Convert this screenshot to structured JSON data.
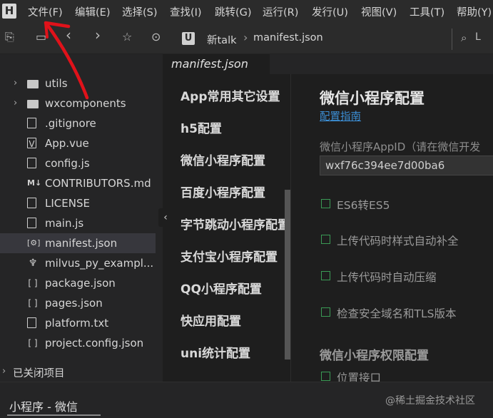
{
  "menu": [
    "文件(F)",
    "编辑(E)",
    "选择(S)",
    "查找(I)",
    "跳转(G)",
    "运行(R)",
    "发行(U)",
    "视图(V)",
    "工具(T)",
    "帮助(Y)"
  ],
  "app_logo": "H",
  "breadcrumb": {
    "logo": "U",
    "project": "新talk",
    "separator": "›",
    "file": "manifest.json"
  },
  "toolbar_icons": [
    "save-icon",
    "file-icon",
    "back-icon",
    "forward-icon",
    "star-icon",
    "run-icon"
  ],
  "search": {
    "label": "L"
  },
  "sidebar": {
    "items": [
      {
        "label": "utils",
        "icon": "folder-icon",
        "expandable": true
      },
      {
        "label": "wxcomponents",
        "icon": "folder-icon",
        "expandable": true
      },
      {
        "label": ".gitignore",
        "icon": "file-icon",
        "expandable": false
      },
      {
        "label": "App.vue",
        "icon": "vue-icon",
        "expandable": false
      },
      {
        "label": "config.js",
        "icon": "js-file-icon",
        "expandable": false
      },
      {
        "label": "CONTRIBUTORS.md",
        "icon": "markdown-icon",
        "expandable": false
      },
      {
        "label": "LICENSE",
        "icon": "file-icon",
        "expandable": false
      },
      {
        "label": "main.js",
        "icon": "js-file-icon",
        "expandable": false
      },
      {
        "label": "manifest.json",
        "icon": "settings-file-icon",
        "expandable": false,
        "selected": true
      },
      {
        "label": "milvus_py_exampl...",
        "icon": "python-icon",
        "expandable": false
      },
      {
        "label": "package.json",
        "icon": "json-icon",
        "expandable": false
      },
      {
        "label": "pages.json",
        "icon": "json-icon",
        "expandable": false
      },
      {
        "label": "platform.txt",
        "icon": "file-icon",
        "expandable": false
      },
      {
        "label": "project.config.json",
        "icon": "json-icon",
        "expandable": false
      }
    ],
    "closed_projects": "已关闭项目"
  },
  "tab": {
    "label": "manifest.json"
  },
  "nav": [
    "App常用其它设置",
    "h5配置",
    "微信小程序配置",
    "百度小程序配置",
    "字节跳动小程序配置",
    "支付宝小程序配置",
    "QQ小程序配置",
    "快应用配置",
    "uni统计配置"
  ],
  "content": {
    "heading": "微信小程序配置",
    "guide_link": "配置指南",
    "appid_label": "微信小程序AppID（请在微信开发",
    "appid_value": "wxf76c394ee7d00ba6",
    "checkboxes": [
      "ES6转ES5",
      "上传代码时样式自动补全",
      "上传代码时自动压缩",
      "检查安全域名和TLS版本"
    ],
    "permissions_heading": "微信小程序权限配置",
    "location_checkbox": "位置接口"
  },
  "status": {
    "text": "小程序 - 微信"
  },
  "watermark": "@稀土掘金技术社区",
  "colors": {
    "accent": "#3c8fd6",
    "checkbox": "#3a9a55",
    "annotation": "#e0121a"
  }
}
